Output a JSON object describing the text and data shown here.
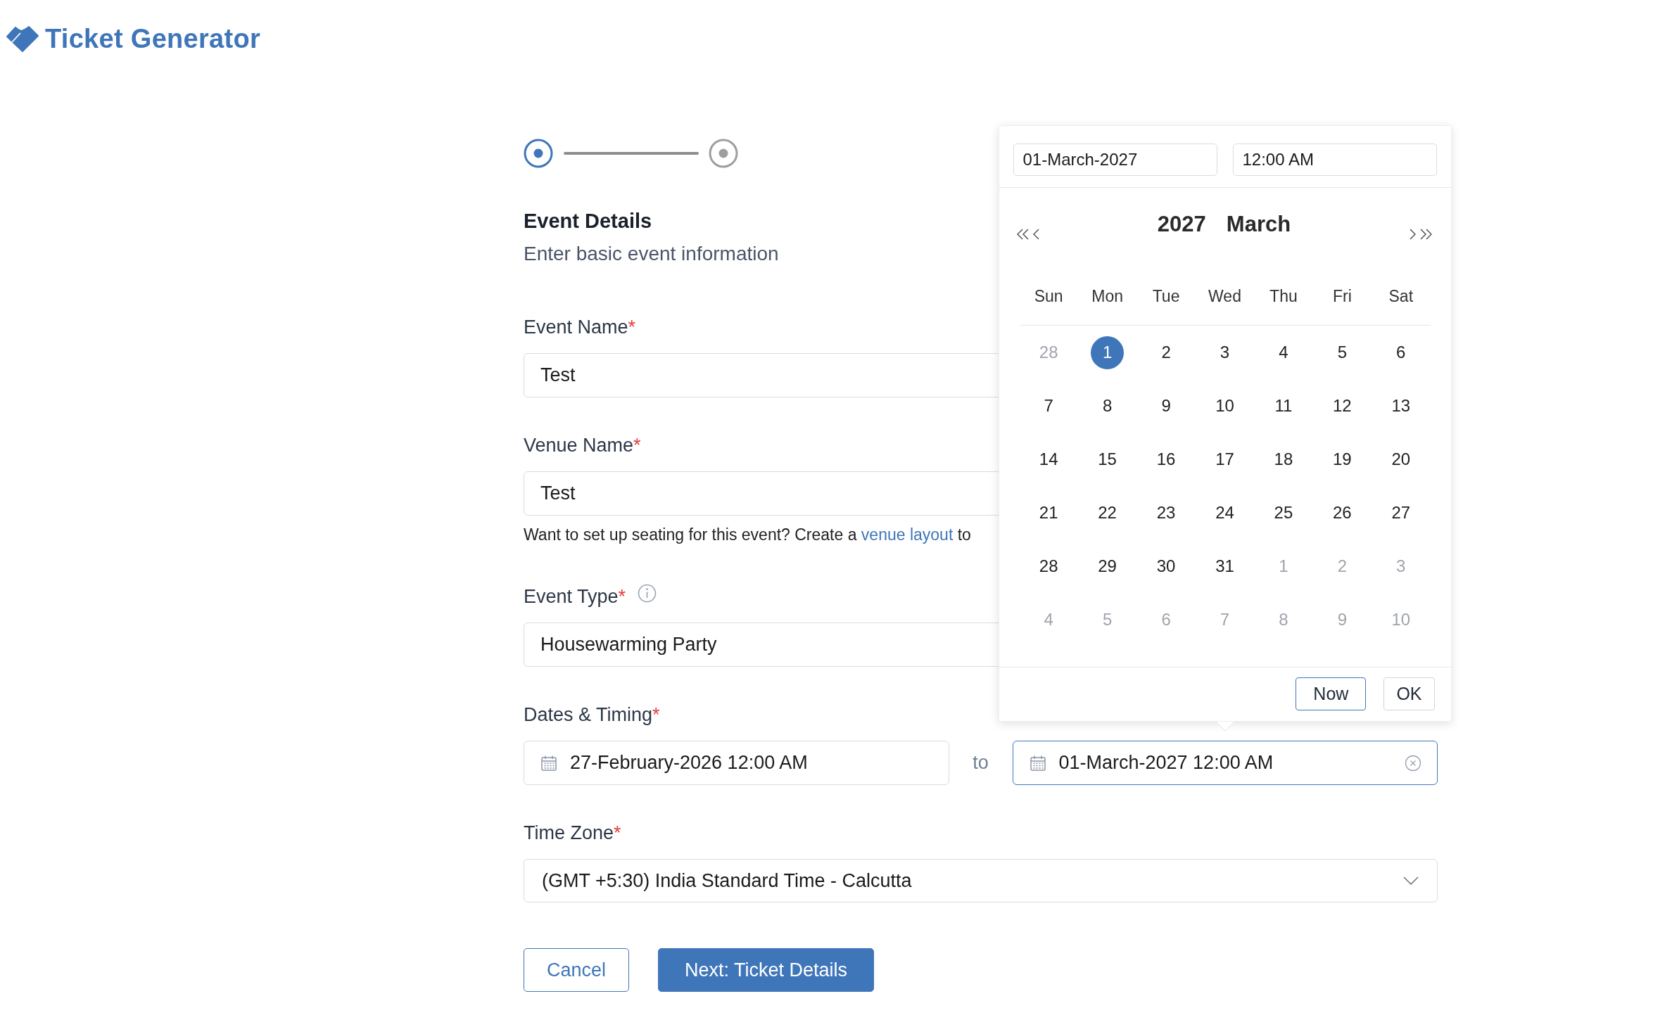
{
  "app": {
    "title": "Ticket Generator"
  },
  "steps": [
    {
      "selected": true
    },
    {
      "selected": false
    }
  ],
  "section": {
    "title": "Event Details",
    "subtitle": "Enter basic event information"
  },
  "fields": [
    {
      "kind": "text",
      "label": "Event Name",
      "required_mark": "*",
      "info": false,
      "value": "Test"
    },
    {
      "kind": "text",
      "label": "Venue Name",
      "required_mark": "*",
      "info": false,
      "value": "Test",
      "help": {
        "before": "Want to set up seating for this event? Create a ",
        "link": "venue layout",
        "after": " to"
      }
    },
    {
      "kind": "text",
      "label": "Event Type",
      "required_mark": "*",
      "info": true,
      "value": "Housewarming Party"
    },
    {
      "kind": "daterange",
      "label": "Dates & Timing",
      "required_mark": "*",
      "info": false,
      "start": {
        "value": "27-February-2026 12:00 AM",
        "focused": false
      },
      "separator": "to",
      "end": {
        "value": "01-March-2027 12:00 AM",
        "focused": true
      }
    },
    {
      "kind": "select",
      "label": "Time Zone",
      "required_mark": "*",
      "info": false,
      "value": "(GMT +5:30) India Standard Time - Calcutta"
    }
  ],
  "date_picker": {
    "date_value": "01-March-2027",
    "time_value": "12:00 AM",
    "year": "2027",
    "month": "March",
    "weekdays": [
      "Sun",
      "Mon",
      "Tue",
      "Wed",
      "Thu",
      "Fri",
      "Sat"
    ],
    "weeks": [
      [
        {
          "day": "28",
          "in_month": false,
          "selected": false
        },
        {
          "day": "1",
          "in_month": true,
          "selected": true
        },
        {
          "day": "2",
          "in_month": true,
          "selected": false
        },
        {
          "day": "3",
          "in_month": true,
          "selected": false
        },
        {
          "day": "4",
          "in_month": true,
          "selected": false
        },
        {
          "day": "5",
          "in_month": true,
          "selected": false
        },
        {
          "day": "6",
          "in_month": true,
          "selected": false
        }
      ],
      [
        {
          "day": "7",
          "in_month": true,
          "selected": false
        },
        {
          "day": "8",
          "in_month": true,
          "selected": false
        },
        {
          "day": "9",
          "in_month": true,
          "selected": false
        },
        {
          "day": "10",
          "in_month": true,
          "selected": false
        },
        {
          "day": "11",
          "in_month": true,
          "selected": false
        },
        {
          "day": "12",
          "in_month": true,
          "selected": false
        },
        {
          "day": "13",
          "in_month": true,
          "selected": false
        }
      ],
      [
        {
          "day": "14",
          "in_month": true,
          "selected": false
        },
        {
          "day": "15",
          "in_month": true,
          "selected": false
        },
        {
          "day": "16",
          "in_month": true,
          "selected": false
        },
        {
          "day": "17",
          "in_month": true,
          "selected": false
        },
        {
          "day": "18",
          "in_month": true,
          "selected": false
        },
        {
          "day": "19",
          "in_month": true,
          "selected": false
        },
        {
          "day": "20",
          "in_month": true,
          "selected": false
        }
      ],
      [
        {
          "day": "21",
          "in_month": true,
          "selected": false
        },
        {
          "day": "22",
          "in_month": true,
          "selected": false
        },
        {
          "day": "23",
          "in_month": true,
          "selected": false
        },
        {
          "day": "24",
          "in_month": true,
          "selected": false
        },
        {
          "day": "25",
          "in_month": true,
          "selected": false
        },
        {
          "day": "26",
          "in_month": true,
          "selected": false
        },
        {
          "day": "27",
          "in_month": true,
          "selected": false
        }
      ],
      [
        {
          "day": "28",
          "in_month": true,
          "selected": false
        },
        {
          "day": "29",
          "in_month": true,
          "selected": false
        },
        {
          "day": "30",
          "in_month": true,
          "selected": false
        },
        {
          "day": "31",
          "in_month": true,
          "selected": false
        },
        {
          "day": "1",
          "in_month": false,
          "selected": false
        },
        {
          "day": "2",
          "in_month": false,
          "selected": false
        },
        {
          "day": "3",
          "in_month": false,
          "selected": false
        }
      ],
      [
        {
          "day": "4",
          "in_month": false,
          "selected": false
        },
        {
          "day": "5",
          "in_month": false,
          "selected": false
        },
        {
          "day": "6",
          "in_month": false,
          "selected": false
        },
        {
          "day": "7",
          "in_month": false,
          "selected": false
        },
        {
          "day": "8",
          "in_month": false,
          "selected": false
        },
        {
          "day": "9",
          "in_month": false,
          "selected": false
        },
        {
          "day": "10",
          "in_month": false,
          "selected": false
        }
      ]
    ],
    "buttons": [
      {
        "label": "Now",
        "kind": "outline"
      },
      {
        "label": "OK",
        "kind": "default"
      }
    ]
  },
  "buttons": [
    {
      "label": "Cancel",
      "kind": "outline"
    },
    {
      "label": "Next: Ticket Details",
      "kind": "primary"
    }
  ]
}
